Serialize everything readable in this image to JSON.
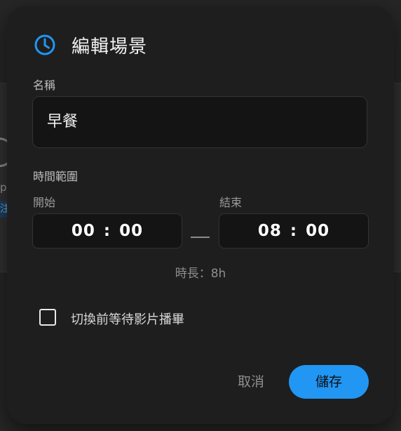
{
  "background": {
    "partial_text": "p",
    "partial_chip_text": "注"
  },
  "dialog": {
    "title": "編輯場景",
    "title_icon": "clock-icon",
    "accent_color": "#2196f3",
    "name_label": "名稱",
    "name_value": "早餐",
    "time_range_label": "時間範圍",
    "start_label": "開始",
    "end_label": "結束",
    "start_time": {
      "hours": "00",
      "sep": ":",
      "minutes": "00"
    },
    "end_time": {
      "hours": "08",
      "sep": ":",
      "minutes": "00"
    },
    "duration_text": "時長：8h",
    "wait_video_label": "切換前等待影片播畢",
    "wait_video_checked": false,
    "cancel_label": "取消",
    "save_label": "儲存"
  }
}
